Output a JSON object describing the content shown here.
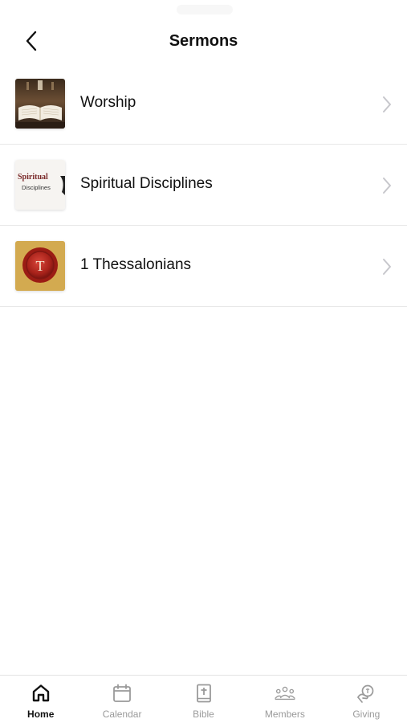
{
  "header": {
    "title": "Sermons",
    "back_icon": "chevron-left-icon"
  },
  "sermons": [
    {
      "title": "Worship",
      "thumb": "open-bible-image"
    },
    {
      "title": "Spiritual Disciplines",
      "thumb": "spiritual-disciplines-image",
      "thumb_line1": "Spiritual",
      "thumb_line2": "Disciplines"
    },
    {
      "title": "1 Thessalonians",
      "thumb": "wax-seal-image",
      "thumb_letter": "T"
    }
  ],
  "tabbar": {
    "tabs": [
      {
        "label": "Home",
        "icon": "home-icon",
        "active": true
      },
      {
        "label": "Calendar",
        "icon": "calendar-icon",
        "active": false
      },
      {
        "label": "Bible",
        "icon": "bible-icon",
        "active": false
      },
      {
        "label": "Members",
        "icon": "members-icon",
        "active": false
      },
      {
        "label": "Giving",
        "icon": "giving-icon",
        "active": false
      }
    ]
  },
  "colors": {
    "active_tab": "#111111",
    "inactive_tab": "#9a9a9a",
    "divider": "#e8e8e8",
    "chevron": "#c7c7cc"
  }
}
